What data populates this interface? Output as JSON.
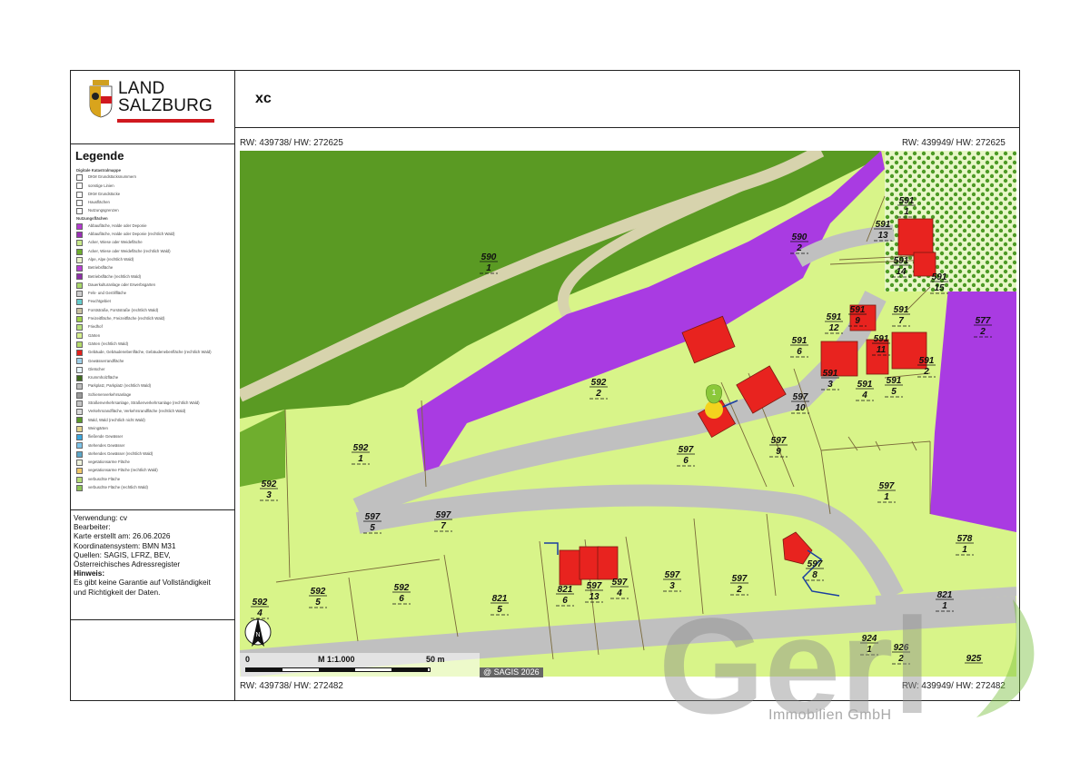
{
  "header": {
    "logo_line1": "LAND",
    "logo_line2": "SALZBURG",
    "title": "xc"
  },
  "legend": {
    "title": "Legende",
    "groups": [
      {
        "heading": "Digitale Katastralmappe",
        "items": [
          {
            "label": "DKM Grundstücksnummern",
            "color": "#ffffff"
          },
          {
            "label": "sonstige Linien",
            "color": "#ffffff"
          },
          {
            "label": "DKM Grundstücke",
            "color": "#ffffff"
          },
          {
            "label": "Hausflächen",
            "color": "#ffffff"
          },
          {
            "label": "Nutzungsgrenzen",
            "color": "#ffffff"
          }
        ]
      },
      {
        "heading": "Nutzungsflächen",
        "items": [
          {
            "label": "Abbaufläche, Halde oder Deponie",
            "color": "#b43ad0"
          },
          {
            "label": "Abbaufläche, Halde oder Deponie (rechtlich Wald)",
            "color": "#9b2fb6"
          },
          {
            "label": "Acker, Wiese oder Weidefläche",
            "color": "#c8e98a"
          },
          {
            "label": "Acker, Wiese oder Weidefläche (rechtlich Wald)",
            "color": "#6fae2e"
          },
          {
            "label": "Alpe, Alpe (rechtlich Wald)",
            "color": "#e8f3c8"
          },
          {
            "label": "Betriebsfläche",
            "color": "#b83fd4"
          },
          {
            "label": "Betriebsfläche (rechtlich Wald)",
            "color": "#8d2fa8"
          },
          {
            "label": "Dauerkulturanlage oder Erwerbsgarten",
            "color": "#a8d86a"
          },
          {
            "label": "Fels- und Geröllfläche",
            "color": "#cccccc"
          },
          {
            "label": "Feuchtgebiet",
            "color": "#66cccc"
          },
          {
            "label": "Forststraße, Forststraße (rechtlich Wald)",
            "color": "#c9c2a2"
          },
          {
            "label": "Freizeitfläche, Freizeitfläche (rechtlich Wald)",
            "color": "#9fd34a"
          },
          {
            "label": "Friedhof",
            "color": "#b7e07a"
          },
          {
            "label": "Gärten",
            "color": "#d6f08e"
          },
          {
            "label": "Gärten (rechtlich Wald)",
            "color": "#b4db6a"
          },
          {
            "label": "Gebäude, Gebäudenebenfläche, Gebäudenebenfläche (rechtlich Wald)",
            "color": "#e3201b"
          },
          {
            "label": "Gewässerrandfläche",
            "color": "#9fd0e8"
          },
          {
            "label": "Gletscher",
            "color": "#e6f4fb"
          },
          {
            "label": "Krummholzfläche",
            "color": "#3f6b1e"
          },
          {
            "label": "Parkplatz, Parkplatz (rechtlich Wald)",
            "color": "#bdbdbd"
          },
          {
            "label": "Schienenverkehrsanlage",
            "color": "#9a9a9a"
          },
          {
            "label": "Straßenverkehrsanlage, Straßenverkehrsanlage (rechtlich Wald)",
            "color": "#c4c4c4"
          },
          {
            "label": "Verkehrsrandfläche, Verkehrsrandfläche (rechtlich Wald)",
            "color": "#d9d9d9"
          },
          {
            "label": "Wald, Wald (rechtlich nicht Wald)",
            "color": "#5b9a2a"
          },
          {
            "label": "Weingärten",
            "color": "#e2d38a"
          },
          {
            "label": "fließende Gewässer",
            "color": "#3aa6dd"
          },
          {
            "label": "stehendes Gewässer",
            "color": "#7cc3e8"
          },
          {
            "label": "stehendes Gewässer (rechtlich Wald)",
            "color": "#5aa6c8"
          },
          {
            "label": "vegetationsarme Fläche",
            "color": "#eef2dc"
          },
          {
            "label": "vegetationsarme Fläche (rechtlich Wald)",
            "color": "#f0c86a"
          },
          {
            "label": "verbuschte Fläche",
            "color": "#b5dd77"
          },
          {
            "label": "verbuschte Fläche (rechtlich Wald)",
            "color": "#8dc456"
          }
        ]
      }
    ]
  },
  "info": {
    "usage": "Verwendung: cv",
    "editor": "Bearbeiter:",
    "created": "Karte erstellt am: 26.06.2026",
    "crs": "Koordinatensystem: BMN M31",
    "sources": "Quellen: SAGIS, LFRZ, BEV,",
    "sources2": "Österreichisches Adressregister",
    "note_title": "Hinweis:",
    "note1": "Es gibt keine Garantie auf Vollständigkeit",
    "note2": "und Richtigkeit der Daten."
  },
  "coords": {
    "top_left": "RW: 439738/ HW: 272625",
    "top_right": "RW: 439949/ HW: 272625",
    "bottom_left": "RW: 439738/ HW: 272482",
    "bottom_right": "RW: 439949/ HW: 272482"
  },
  "scale": {
    "zero": "0",
    "ratio": "M 1:1.000",
    "distance": "50 m",
    "copyright": "@ SAGIS 2026",
    "north": "N"
  },
  "marker": {
    "label": "1"
  },
  "watermark": {
    "brand": "Gerl",
    "subtitle": "Immobilien GmbH"
  },
  "colors": {
    "forest": "#5a9a23",
    "meadow": "#d8f489",
    "purple": "#a93be2",
    "building": "#e8231f",
    "road": "#c0c0c0",
    "track": "#d7d3ad"
  },
  "parcels": [
    {
      "num": "590",
      "sub": "1"
    },
    {
      "num": "590",
      "sub": "2"
    },
    {
      "num": "591",
      "sub": "1"
    },
    {
      "num": "591",
      "sub": "13"
    },
    {
      "num": "591",
      "sub": "14"
    },
    {
      "num": "591",
      "sub": "15"
    },
    {
      "num": "577",
      "sub": "2"
    },
    {
      "num": "591",
      "sub": "12"
    },
    {
      "num": "591",
      "sub": "9"
    },
    {
      "num": "591",
      "sub": "7"
    },
    {
      "num": "591",
      "sub": "6"
    },
    {
      "num": "591",
      "sub": "11"
    },
    {
      "num": "591",
      "sub": "2"
    },
    {
      "num": "591",
      "sub": "3"
    },
    {
      "num": "591",
      "sub": "4"
    },
    {
      "num": "591",
      "sub": "5"
    },
    {
      "num": "592",
      "sub": "2"
    },
    {
      "num": "597",
      "sub": "10"
    },
    {
      "num": "597",
      "sub": "6"
    },
    {
      "num": "597",
      "sub": "9"
    },
    {
      "num": "592",
      "sub": "1"
    },
    {
      "num": "592",
      "sub": "3"
    },
    {
      "num": "597",
      "sub": "1"
    },
    {
      "num": "597",
      "sub": "5"
    },
    {
      "num": "597",
      "sub": "7"
    },
    {
      "num": "578",
      "sub": "1"
    },
    {
      "num": "597",
      "sub": "8"
    },
    {
      "num": "821",
      "sub": "6"
    },
    {
      "num": "597",
      "sub": "13"
    },
    {
      "num": "597",
      "sub": "4"
    },
    {
      "num": "597",
      "sub": "3"
    },
    {
      "num": "597",
      "sub": "2"
    },
    {
      "num": "592",
      "sub": "5"
    },
    {
      "num": "592",
      "sub": "6"
    },
    {
      "num": "821",
      "sub": "5"
    },
    {
      "num": "592",
      "sub": "4"
    },
    {
      "num": "821",
      "sub": "1"
    },
    {
      "num": "924",
      "sub": "1"
    },
    {
      "num": "926",
      "sub": "2"
    },
    {
      "num": "925",
      "sub": ""
    }
  ]
}
